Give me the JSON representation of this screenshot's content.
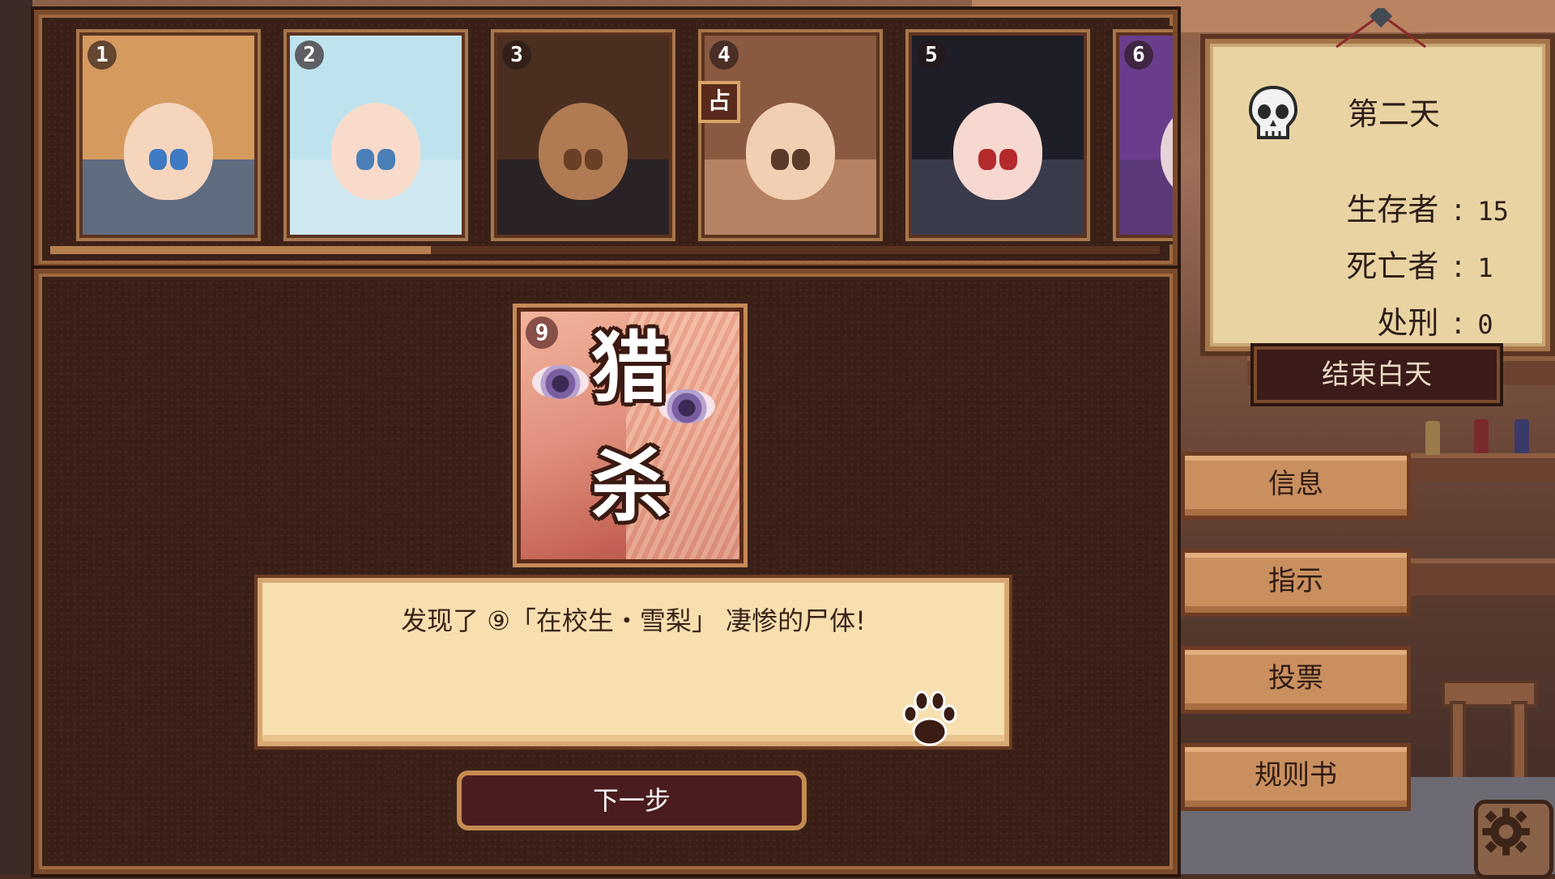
{
  "portraits": [
    {
      "number": "1",
      "hair": "#d59a5e",
      "skin": "#f6d5bd",
      "eyes": "#3f7ac4",
      "bg": "#5f6c80",
      "hat": "#9b6b45"
    },
    {
      "number": "2",
      "hair": "#bfe3ee",
      "skin": "#f9dbcb",
      "eyes": "#4a7fb8",
      "bg": "#cfe8ef"
    },
    {
      "number": "3",
      "hair": "#4a2e20",
      "skin": "#b07a52",
      "eyes": "#6b3f25",
      "bg": "#2a2224"
    },
    {
      "number": "4",
      "hair": "#8a5a40",
      "skin": "#f1cfb2",
      "eyes": "#5a3b2a",
      "bg": "#b58263",
      "tag": "占"
    },
    {
      "number": "5",
      "hair": "#1e1e28",
      "skin": "#f6d8d0",
      "eyes": "#b52a2a",
      "bg": "#3a3b4a"
    },
    {
      "number": "6",
      "hair": "#6a3d8c",
      "skin": "#e6d3d8",
      "eyes": "#6a3d8c",
      "bg": "#5c3a7a"
    }
  ],
  "event_card": {
    "number": "9",
    "char1": "猎",
    "char2": "杀"
  },
  "message": {
    "text": "发现了 ⑨「在校生・雪梨」 凄惨的尸体!"
  },
  "next_button": {
    "label": "下一步"
  },
  "status": {
    "day": "第二天",
    "survivors_label": "生存者",
    "survivors_value": "15",
    "dead_label": "死亡者",
    "dead_value": "1",
    "executed_label": "处刑",
    "executed_value": "0",
    "colon": ":"
  },
  "end_day_button": {
    "label": "结束白天"
  },
  "side_menu": [
    {
      "label": "信息"
    },
    {
      "label": "指示"
    },
    {
      "label": "投票"
    },
    {
      "label": "规则书"
    }
  ],
  "colors": {
    "accent": "#c68b51",
    "panel_bg": "#3a1f17",
    "message_bg": "#f7dfb0"
  },
  "icons": {
    "skull": "skull-icon",
    "paw": "paw-icon",
    "settings": "gear-icon"
  }
}
